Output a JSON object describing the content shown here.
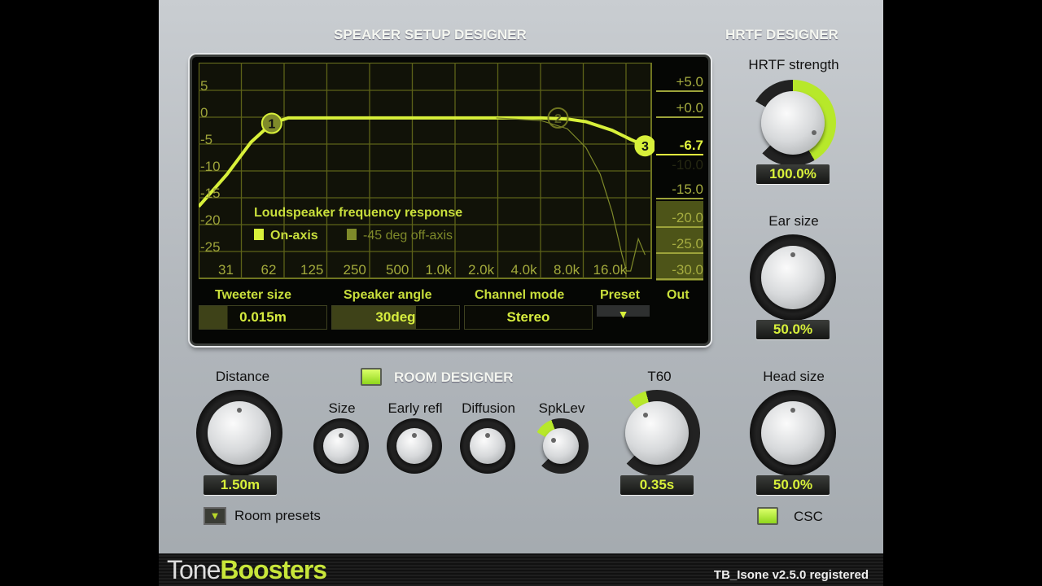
{
  "sections": {
    "speaker": "SPEAKER SETUP DESIGNER",
    "hrtf": "HRTF DESIGNER",
    "room": "ROOM DESIGNER"
  },
  "chart_data": {
    "type": "line",
    "legend_title": "Loudspeaker frequency response",
    "series": [
      {
        "name": "On-axis",
        "color": "#d8f03a",
        "x": [
          20,
          31,
          45,
          62,
          80,
          125,
          250,
          500,
          1000,
          2000,
          4000,
          6000,
          8000,
          12000,
          16000,
          20000
        ],
        "y": [
          -18,
          -12,
          -6,
          -2.5,
          -1.5,
          -1.5,
          -1.5,
          -1.5,
          -1.5,
          -1.5,
          -1.5,
          -1.7,
          -2.2,
          -3.8,
          -5.5,
          -6.7
        ]
      },
      {
        "name": "-45 deg off-axis",
        "color": "#7f8a2a",
        "x": [
          2000,
          4000,
          6000,
          8000,
          10000,
          12000,
          14000,
          15000,
          16000,
          17000,
          18000,
          20000
        ],
        "y": [
          -1.5,
          -2,
          -3.5,
          -7,
          -12,
          -19,
          -27,
          -30,
          -30,
          -27,
          -24,
          -27
        ]
      }
    ],
    "x_ticks": [
      "31",
      "62",
      "125",
      "250",
      "500",
      "1.0k",
      "2.0k",
      "4.0k",
      "8.0k",
      "16.0k"
    ],
    "y_ticks": [
      "5",
      "0",
      "-5",
      "-10",
      "-15",
      "-20",
      "-25"
    ],
    "ylim": [
      -30,
      7
    ],
    "grid": true,
    "points": [
      "1",
      "2",
      "3"
    ]
  },
  "out_meter": {
    "label": "Out",
    "ticks": [
      "+5.0",
      "+0.0",
      "-6.7",
      "-10.0",
      "-15.0",
      "-20.0",
      "-25.0",
      "-30.0"
    ],
    "value_db": -6.7
  },
  "controls": {
    "tweeter": {
      "label": "Tweeter size",
      "value": "0.015m"
    },
    "angle": {
      "label": "Speaker angle",
      "value": "30deg"
    },
    "channel": {
      "label": "Channel mode",
      "value": "Stereo"
    },
    "preset": {
      "label": "Preset"
    }
  },
  "hrtf": {
    "strength": {
      "label": "HRTF strength",
      "value": "100.0%"
    },
    "ear": {
      "label": "Ear size",
      "value": "50.0%"
    },
    "head": {
      "label": "Head size",
      "value": "50.0%"
    },
    "csc": "CSC"
  },
  "room": {
    "distance": {
      "label": "Distance",
      "value": "1.50m"
    },
    "size": "Size",
    "early": "Early refl",
    "diffusion": "Diffusion",
    "spklev": "SpkLev",
    "t60": {
      "label": "T60",
      "value": "0.35s"
    },
    "presets": "Room presets"
  },
  "footer": {
    "brand_a": "Tone",
    "brand_b": "Boosters",
    "version": "TB_Isone v2.5.0 registered"
  }
}
